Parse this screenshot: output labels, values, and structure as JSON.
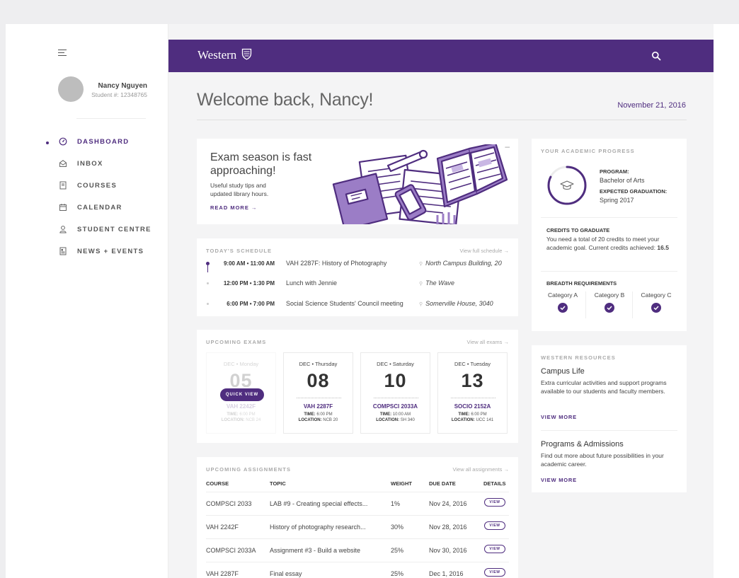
{
  "sidebar": {
    "user_name": "Nancy Nguyen",
    "student_id": "Student #: 12348765",
    "items": [
      {
        "label": "DASHBOARD",
        "icon": "dashboard-icon",
        "active": true
      },
      {
        "label": "INBOX",
        "icon": "inbox-icon"
      },
      {
        "label": "COURSES",
        "icon": "courses-icon"
      },
      {
        "label": "CALENDAR",
        "icon": "calendar-icon"
      },
      {
        "label": "STUDENT CENTRE",
        "icon": "user-icon"
      },
      {
        "label": "NEWS + EVENTS",
        "icon": "news-icon"
      }
    ]
  },
  "topbar": {
    "brand": "Western",
    "search_icon": "search-icon"
  },
  "header": {
    "welcome": "Welcome back, Nancy!",
    "date": "November 21, 2016"
  },
  "exam_promo": {
    "headline": "Exam season is fast approaching!",
    "subtext": "Useful study tips and updated library hours.",
    "link": "READ MORE →",
    "minimize": "–"
  },
  "schedule": {
    "title": "TODAY'S SCHEDULE",
    "link": "View full schedule →",
    "events": [
      {
        "time": "9:00 AM • 11:00 AM",
        "event": "VAH 2287F: History of Photography",
        "location": "North Campus Building, 20"
      },
      {
        "time": "12:00 PM • 1:30 PM",
        "event": "Lunch with Jennie",
        "location": "The Wave"
      },
      {
        "time": "6:00 PM • 7:00 PM",
        "event": "Social Science Students' Council meeting",
        "location": "Somerville House, 3040"
      }
    ]
  },
  "exams": {
    "title": "UPCOMING EXAMS",
    "link": "View all exams →",
    "quick_view": "QUICK VIEW",
    "time_label": "TIME:",
    "location_label": "LOCATION:",
    "items": [
      {
        "day": "DEC • Monday",
        "date": "05",
        "course": "VAH 2242F",
        "time": "6:00 PM",
        "location": "NCB 24"
      },
      {
        "day": "DEC • Thursday",
        "date": "08",
        "course": "VAH 2287F",
        "time": "6:00 PM",
        "location": "NCB 20"
      },
      {
        "day": "DEC • Saturday",
        "date": "10",
        "course": "COMPSCI 2033A",
        "time": "10:00 AM",
        "location": "SH 340"
      },
      {
        "day": "DEC • Tuesday",
        "date": "13",
        "course": "SOCIO 2152A",
        "time": "6:00 PM",
        "location": "UCC 141"
      }
    ]
  },
  "assignments": {
    "title": "UPCOMING ASSIGNMENTS",
    "link": "View all assignments →",
    "columns": [
      "COURSE",
      "TOPIC",
      "WEIGHT",
      "DUE DATE",
      "DETAILS"
    ],
    "view_label": "VIEW",
    "rows": [
      {
        "course": "COMPSCI 2033",
        "topic": "LAB #9 - Creating special effects...",
        "weight": "1%",
        "due": "Nov 24, 2016"
      },
      {
        "course": "VAH 2242F",
        "topic": "History of photography research...",
        "weight": "30%",
        "due": "Nov 28, 2016"
      },
      {
        "course": "COMPSCI 2033A",
        "topic": "Assignment #3 - Build a website",
        "weight": "25%",
        "due": "Nov 30, 2016"
      },
      {
        "course": "VAH 2287F",
        "topic": "Final essay",
        "weight": "25%",
        "due": "Dec 1, 2016"
      }
    ]
  },
  "progress": {
    "title": "YOUR ACADEMIC PROGRESS",
    "program_label": "PROGRAM:",
    "program": "Bachelor of Arts",
    "graduation_label": "EXPECTED GRADUATION:",
    "graduation": "Spring 2017",
    "credits_title": "CREDITS TO GRADUATE",
    "credits_text": "You need a total of 20 credits to meet your academic goal. Current credits achieved:",
    "credits_value": "16.5",
    "credits_fraction": 0.825,
    "breadth_title": "BREADTH REQUIREMENTS",
    "categories": [
      "Category A",
      "Category B",
      "Category C"
    ]
  },
  "resources": {
    "title": "WESTERN RESOURCES",
    "items": [
      {
        "title": "Campus Life",
        "text": "Extra curricular activities and support programs available to our students and faculty members.",
        "link": "VIEW MORE"
      },
      {
        "title": "Programs & Admissions",
        "text": "Find out more about future possibilities in your academic career.",
        "link": "VIEW MORE"
      }
    ]
  },
  "colors": {
    "brand": "#4f2d7f",
    "page": "#f4f4f5"
  }
}
